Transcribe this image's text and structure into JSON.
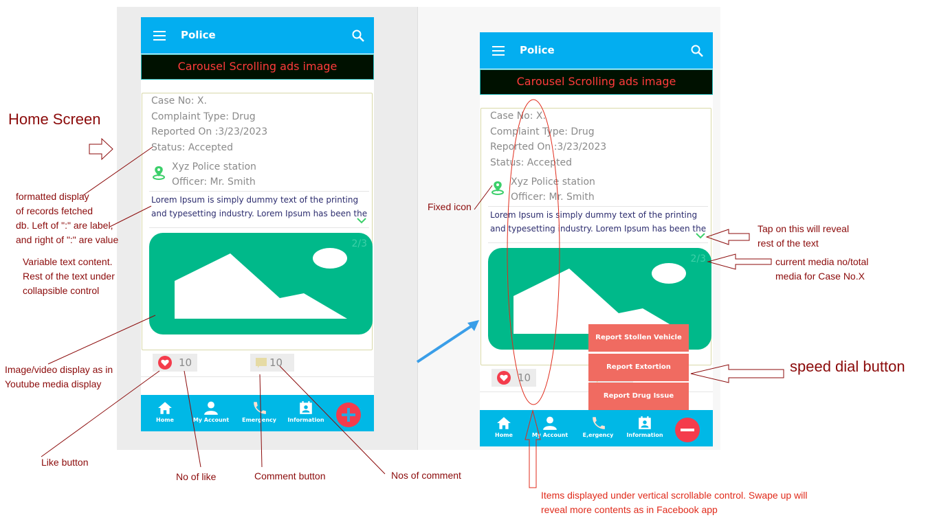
{
  "phones": [
    {
      "header_title": "Police",
      "ad_banner": "Carousel Scrolling ads image",
      "case_no": "Case No: X.",
      "complaint_type": "Complaint Type: Drug",
      "reported_on": "Reported On :3/23/2023",
      "status": "Status: Accepted",
      "station": "Xyz Police station",
      "officer": "Officer: Mr. Smith",
      "description": "Lorem Ipsum is simply dummy text of the printing and typesetting industry. Lorem Ipsum has been the industry's",
      "media_counter": "2/3",
      "like_count": "10",
      "comment_count": "10",
      "nav": [
        "Home",
        "My Account",
        "Emergency",
        "Information"
      ],
      "fab_icon": "plus-icon"
    },
    {
      "header_title": "Police",
      "ad_banner": "Carousel Scrolling ads image",
      "case_no": "Case No: X.",
      "complaint_type": "Complaint Type: Drug",
      "reported_on": "Reported On :3/23/2023",
      "status": "Status: Accepted",
      "station": "Xyz Police station",
      "officer": "Officer: Mr. Smith",
      "description": "Lorem Ipsum is simply dummy text of the printing and typesetting industry. Lorem Ipsum has been the industry's",
      "media_counter": "2/3",
      "like_count": "10",
      "comment_count": "10",
      "nav": [
        "Home",
        "My Account",
        "E,ergency",
        "Information"
      ],
      "fab_icon": "minus-icon",
      "speed_dial": [
        "Report Stollen Vehicle",
        "Report Extortion",
        "Report Drug Issue"
      ]
    }
  ],
  "annotations": {
    "home_screen": "Home Screen",
    "formatted": [
      "formatted display",
      "of records fetched",
      "db. Left of \":\" are label,",
      "and right of \":\" are value"
    ],
    "variable": [
      "Variable text content.",
      "Rest of the text under",
      "collapsible control"
    ],
    "image_video": [
      "Image/video display as in",
      "Youtube media display"
    ],
    "like_button": "Like button",
    "no_of_like": "No of like",
    "comment_button": "Comment button",
    "nos_of_comment": "Nos of comment",
    "fixed_icon": "Fixed icon",
    "tap_reveal": [
      "Tap on this will reveal",
      "rest of the text"
    ],
    "current_media": [
      "current media no/total",
      "media for Case No.X"
    ],
    "speed_dial": "speed dial button",
    "scrollable": [
      "Items displayed under vertical scrollable control.  Swape up will",
      "reveal more contents as in Facebook app"
    ]
  },
  "colors": {
    "header": "#03aef0",
    "nav": "#00b8e6",
    "media": "#00b98a",
    "fab": "#f43c4c",
    "speed_dial": "#f06b61",
    "annotation": "#8b0a0a"
  }
}
